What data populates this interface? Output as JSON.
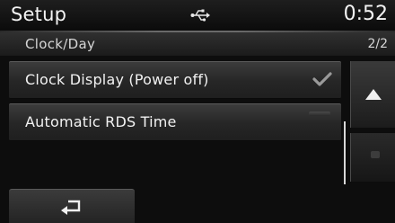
{
  "header": {
    "title": "Setup",
    "status_icon": "usb-icon",
    "time": "0:52"
  },
  "subheader": {
    "breadcrumb": "Clock/Day",
    "page_indicator": "2/2"
  },
  "menu": {
    "items": [
      {
        "label": "Clock Display (Power off)",
        "state": "checked",
        "indicator_icon": "check-icon"
      },
      {
        "label": "Automatic RDS Time",
        "state": "off",
        "indicator_icon": "off-indicator"
      }
    ]
  },
  "scroll": {
    "up_icon": "triangle-up-icon",
    "down_icon": "triangle-down-icon"
  },
  "footer": {
    "back_icon": "return-arrow-icon"
  },
  "colors": {
    "background": "#0d0d0d",
    "text": "#f2f2f2",
    "item_gradient_top": "#3c3c3c",
    "item_gradient_bottom": "#1f1f1f"
  }
}
